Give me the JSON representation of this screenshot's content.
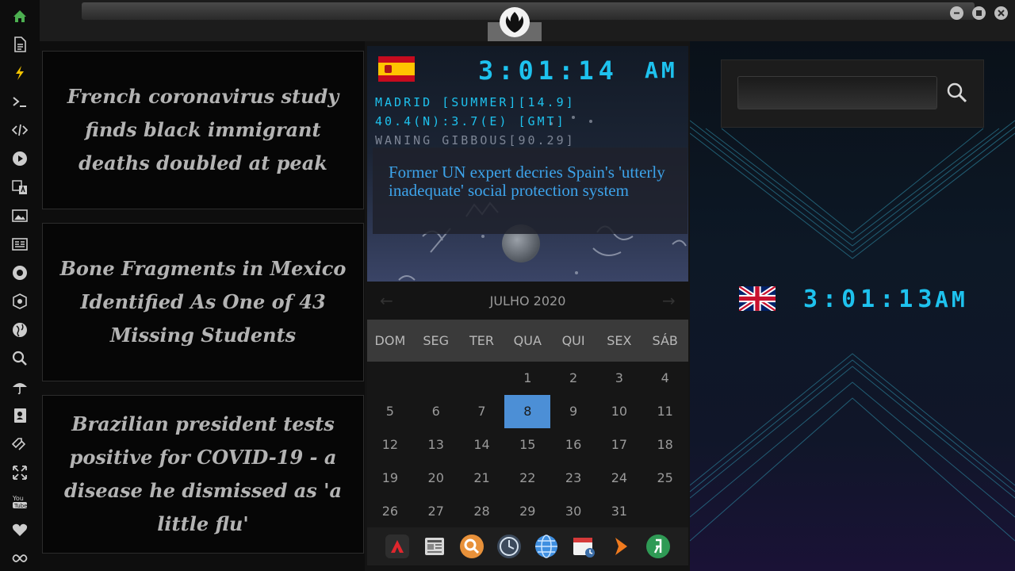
{
  "sidebar": {
    "icons": [
      "home-icon",
      "document-icon",
      "lightning-icon",
      "terminal-icon",
      "code-icon",
      "play-icon",
      "translate-icon",
      "image-icon",
      "news-icon",
      "rebel-icon",
      "empire-icon",
      "globe-icon",
      "search-icon",
      "umbrella-icon",
      "contacts-icon",
      "tag-icon",
      "expand-icon",
      "youtube-icon",
      "heart-icon",
      "infinity-icon"
    ],
    "accent": "#4caf50"
  },
  "news": {
    "items": [
      {
        "headline": "French coronavirus study finds black immigrant deaths doubled at peak"
      },
      {
        "headline": "Bone Fragments in Mexico Identified As One of 43 Missing Students"
      },
      {
        "headline": "Brazilian president tests positive for COVID-19 - a disease he dismissed as 'a little flu'"
      }
    ]
  },
  "clock_spain": {
    "time": "3:01:14",
    "ampm": "AM",
    "line1": "MADRID [SUMMER][14.9]",
    "line2": "40.4(N):3.7(E) [GMT]",
    "line3": "WANING GIBBOUS[90.29]",
    "headline": "Former UN expert decries Spain's 'utterly inadequate' social protection system",
    "color": "#1ec2ee"
  },
  "calendar": {
    "title": "JULHO 2020",
    "weekdays": [
      "DOM",
      "SEG",
      "TER",
      "QUA",
      "QUI",
      "SEX",
      "SÁB"
    ],
    "weeks": [
      [
        "",
        "",
        "",
        "1",
        "2",
        "3",
        "4"
      ],
      [
        "5",
        "6",
        "7",
        "8",
        "9",
        "10",
        "11"
      ],
      [
        "12",
        "13",
        "14",
        "15",
        "16",
        "17",
        "18"
      ],
      [
        "19",
        "20",
        "21",
        "22",
        "23",
        "24",
        "25"
      ],
      [
        "26",
        "27",
        "28",
        "29",
        "30",
        "31",
        ""
      ]
    ],
    "today": "8",
    "today_color": "#4c8fd6"
  },
  "dock": {
    "apps": [
      "autocad-icon",
      "newspaper-icon",
      "magnifier-icon",
      "clock-icon",
      "globe-icon",
      "calendar-icon",
      "arrow-icon",
      "yandex-icon"
    ]
  },
  "clock_uk": {
    "time": "3:01:13",
    "ampm": "AM"
  }
}
